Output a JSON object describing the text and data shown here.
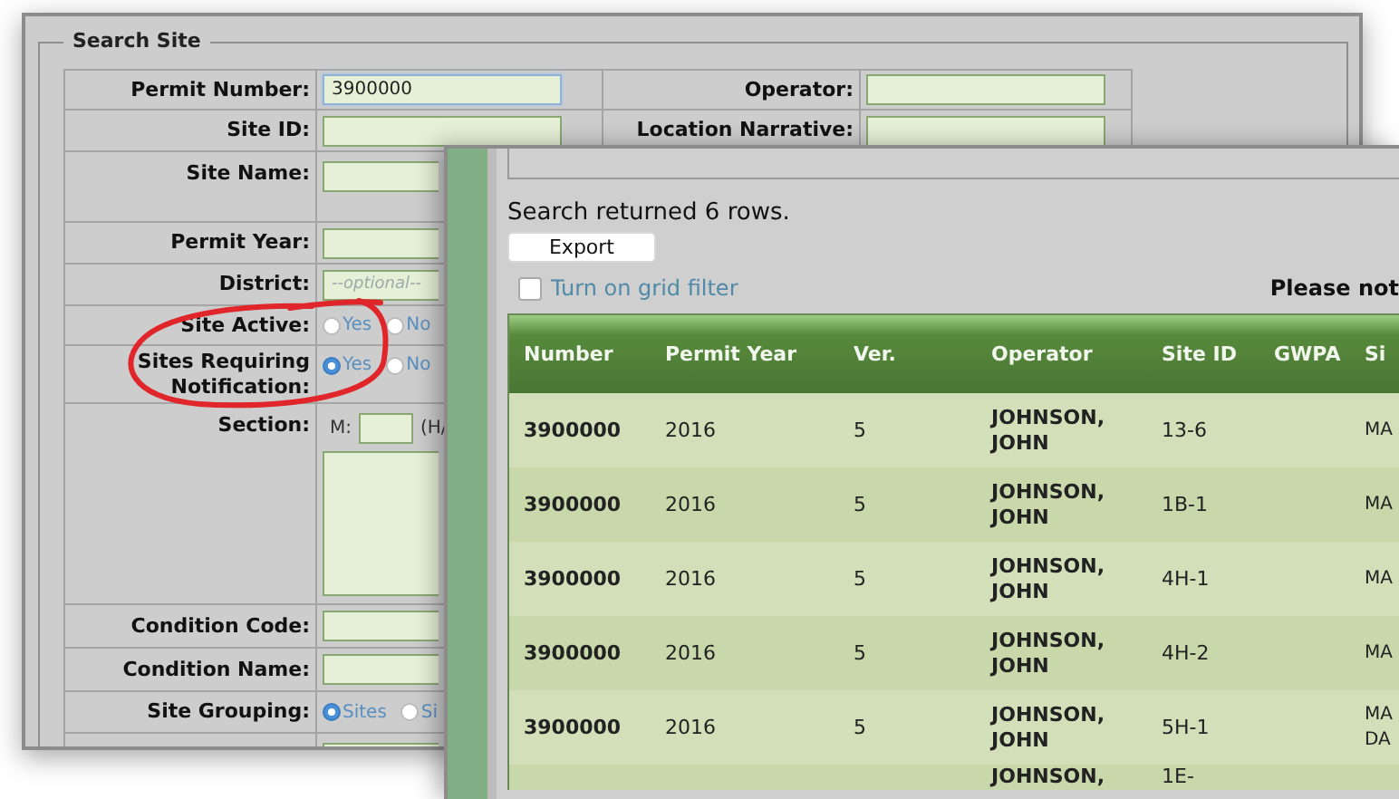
{
  "search_window": {
    "legend": "Search Site",
    "fields": [
      {
        "kind": "text",
        "label": "Permit Number:",
        "value": "3900000",
        "focused": true
      },
      {
        "kind": "text",
        "label": "Site ID:"
      },
      {
        "kind": "tall",
        "label": "Site Name:"
      },
      {
        "kind": "text",
        "label": "Permit Year:"
      },
      {
        "kind": "text",
        "label": "District:",
        "placeholder": "--optional--"
      },
      {
        "kind": "radio",
        "label": "Site Active:",
        "options": [
          {
            "label": "Yes",
            "selected": false
          },
          {
            "label": "No",
            "selected": false
          }
        ]
      },
      {
        "kind": "radio",
        "label": "Sites Requiring Notification:",
        "options": [
          {
            "label": "Yes",
            "selected": true
          },
          {
            "label": "No",
            "selected": false
          }
        ]
      },
      {
        "kind": "section",
        "label": "Section:",
        "prefix": "M:",
        "suffix": "(H/"
      },
      {
        "kind": "text",
        "label": "Condition Code:"
      },
      {
        "kind": "text",
        "label": "Condition Name:"
      },
      {
        "kind": "radio",
        "label": "Site Grouping:",
        "options": [
          {
            "label": "Sites",
            "selected": true
          },
          {
            "label": "Si",
            "selected": false
          }
        ]
      },
      {
        "kind": "code"
      }
    ],
    "right_fields": [
      {
        "label": "Operator:"
      },
      {
        "label": "Location Narrative:"
      }
    ]
  },
  "results_window": {
    "summary": "Search returned 6 rows.",
    "export_button": "Export",
    "grid_filter": {
      "label": "Turn on grid filter",
      "checked": false
    },
    "notice": "Please not",
    "table": {
      "columns": [
        "Number",
        "Permit Year",
        "Ver.",
        "Operator",
        "Site ID",
        "GWPA",
        "Si"
      ],
      "rows": [
        [
          "3900000",
          "2016",
          "5",
          "JOHNSON, JOHN",
          "13-6",
          "",
          "MA"
        ],
        [
          "3900000",
          "2016",
          "5",
          "JOHNSON, JOHN",
          "1B-1",
          "",
          "MA"
        ],
        [
          "3900000",
          "2016",
          "5",
          "JOHNSON, JOHN",
          "4H-1",
          "",
          "MA"
        ],
        [
          "3900000",
          "2016",
          "5",
          "JOHNSON, JOHN",
          "4H-2",
          "",
          "MA"
        ],
        [
          "3900000",
          "2016",
          "5",
          "JOHNSON, JOHN",
          "5H-1",
          "",
          "MA DA"
        ],
        [
          "",
          "",
          "",
          "JOHNSON,",
          "1E-",
          "",
          ""
        ]
      ]
    }
  }
}
